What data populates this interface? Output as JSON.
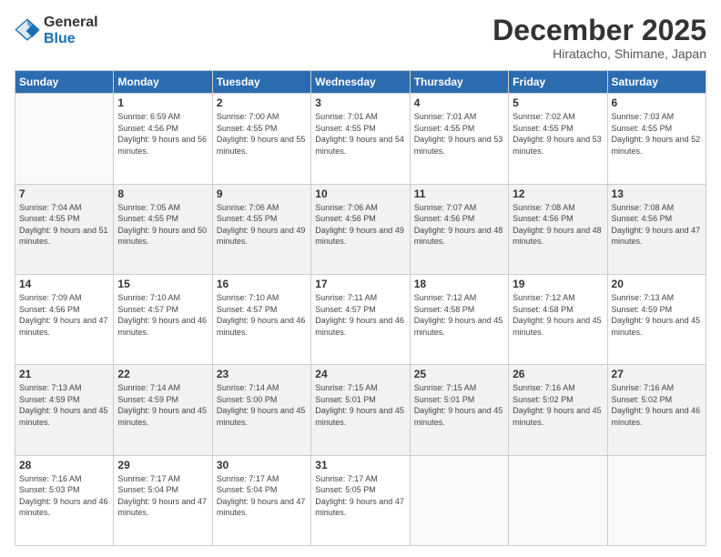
{
  "logo": {
    "line1": "General",
    "line2": "Blue"
  },
  "title": "December 2025",
  "subtitle": "Hiratacho, Shimane, Japan",
  "weekdays": [
    "Sunday",
    "Monday",
    "Tuesday",
    "Wednesday",
    "Thursday",
    "Friday",
    "Saturday"
  ],
  "weeks": [
    [
      {
        "day": "",
        "sunrise": "",
        "sunset": "",
        "daylight": ""
      },
      {
        "day": "1",
        "sunrise": "Sunrise: 6:59 AM",
        "sunset": "Sunset: 4:56 PM",
        "daylight": "Daylight: 9 hours and 56 minutes."
      },
      {
        "day": "2",
        "sunrise": "Sunrise: 7:00 AM",
        "sunset": "Sunset: 4:55 PM",
        "daylight": "Daylight: 9 hours and 55 minutes."
      },
      {
        "day": "3",
        "sunrise": "Sunrise: 7:01 AM",
        "sunset": "Sunset: 4:55 PM",
        "daylight": "Daylight: 9 hours and 54 minutes."
      },
      {
        "day": "4",
        "sunrise": "Sunrise: 7:01 AM",
        "sunset": "Sunset: 4:55 PM",
        "daylight": "Daylight: 9 hours and 53 minutes."
      },
      {
        "day": "5",
        "sunrise": "Sunrise: 7:02 AM",
        "sunset": "Sunset: 4:55 PM",
        "daylight": "Daylight: 9 hours and 53 minutes."
      },
      {
        "day": "6",
        "sunrise": "Sunrise: 7:03 AM",
        "sunset": "Sunset: 4:55 PM",
        "daylight": "Daylight: 9 hours and 52 minutes."
      }
    ],
    [
      {
        "day": "7",
        "sunrise": "Sunrise: 7:04 AM",
        "sunset": "Sunset: 4:55 PM",
        "daylight": "Daylight: 9 hours and 51 minutes."
      },
      {
        "day": "8",
        "sunrise": "Sunrise: 7:05 AM",
        "sunset": "Sunset: 4:55 PM",
        "daylight": "Daylight: 9 hours and 50 minutes."
      },
      {
        "day": "9",
        "sunrise": "Sunrise: 7:06 AM",
        "sunset": "Sunset: 4:55 PM",
        "daylight": "Daylight: 9 hours and 49 minutes."
      },
      {
        "day": "10",
        "sunrise": "Sunrise: 7:06 AM",
        "sunset": "Sunset: 4:56 PM",
        "daylight": "Daylight: 9 hours and 49 minutes."
      },
      {
        "day": "11",
        "sunrise": "Sunrise: 7:07 AM",
        "sunset": "Sunset: 4:56 PM",
        "daylight": "Daylight: 9 hours and 48 minutes."
      },
      {
        "day": "12",
        "sunrise": "Sunrise: 7:08 AM",
        "sunset": "Sunset: 4:56 PM",
        "daylight": "Daylight: 9 hours and 48 minutes."
      },
      {
        "day": "13",
        "sunrise": "Sunrise: 7:08 AM",
        "sunset": "Sunset: 4:56 PM",
        "daylight": "Daylight: 9 hours and 47 minutes."
      }
    ],
    [
      {
        "day": "14",
        "sunrise": "Sunrise: 7:09 AM",
        "sunset": "Sunset: 4:56 PM",
        "daylight": "Daylight: 9 hours and 47 minutes."
      },
      {
        "day": "15",
        "sunrise": "Sunrise: 7:10 AM",
        "sunset": "Sunset: 4:57 PM",
        "daylight": "Daylight: 9 hours and 46 minutes."
      },
      {
        "day": "16",
        "sunrise": "Sunrise: 7:10 AM",
        "sunset": "Sunset: 4:57 PM",
        "daylight": "Daylight: 9 hours and 46 minutes."
      },
      {
        "day": "17",
        "sunrise": "Sunrise: 7:11 AM",
        "sunset": "Sunset: 4:57 PM",
        "daylight": "Daylight: 9 hours and 46 minutes."
      },
      {
        "day": "18",
        "sunrise": "Sunrise: 7:12 AM",
        "sunset": "Sunset: 4:58 PM",
        "daylight": "Daylight: 9 hours and 45 minutes."
      },
      {
        "day": "19",
        "sunrise": "Sunrise: 7:12 AM",
        "sunset": "Sunset: 4:58 PM",
        "daylight": "Daylight: 9 hours and 45 minutes."
      },
      {
        "day": "20",
        "sunrise": "Sunrise: 7:13 AM",
        "sunset": "Sunset: 4:59 PM",
        "daylight": "Daylight: 9 hours and 45 minutes."
      }
    ],
    [
      {
        "day": "21",
        "sunrise": "Sunrise: 7:13 AM",
        "sunset": "Sunset: 4:59 PM",
        "daylight": "Daylight: 9 hours and 45 minutes."
      },
      {
        "day": "22",
        "sunrise": "Sunrise: 7:14 AM",
        "sunset": "Sunset: 4:59 PM",
        "daylight": "Daylight: 9 hours and 45 minutes."
      },
      {
        "day": "23",
        "sunrise": "Sunrise: 7:14 AM",
        "sunset": "Sunset: 5:00 PM",
        "daylight": "Daylight: 9 hours and 45 minutes."
      },
      {
        "day": "24",
        "sunrise": "Sunrise: 7:15 AM",
        "sunset": "Sunset: 5:01 PM",
        "daylight": "Daylight: 9 hours and 45 minutes."
      },
      {
        "day": "25",
        "sunrise": "Sunrise: 7:15 AM",
        "sunset": "Sunset: 5:01 PM",
        "daylight": "Daylight: 9 hours and 45 minutes."
      },
      {
        "day": "26",
        "sunrise": "Sunrise: 7:16 AM",
        "sunset": "Sunset: 5:02 PM",
        "daylight": "Daylight: 9 hours and 45 minutes."
      },
      {
        "day": "27",
        "sunrise": "Sunrise: 7:16 AM",
        "sunset": "Sunset: 5:02 PM",
        "daylight": "Daylight: 9 hours and 46 minutes."
      }
    ],
    [
      {
        "day": "28",
        "sunrise": "Sunrise: 7:16 AM",
        "sunset": "Sunset: 5:03 PM",
        "daylight": "Daylight: 9 hours and 46 minutes."
      },
      {
        "day": "29",
        "sunrise": "Sunrise: 7:17 AM",
        "sunset": "Sunset: 5:04 PM",
        "daylight": "Daylight: 9 hours and 47 minutes."
      },
      {
        "day": "30",
        "sunrise": "Sunrise: 7:17 AM",
        "sunset": "Sunset: 5:04 PM",
        "daylight": "Daylight: 9 hours and 47 minutes."
      },
      {
        "day": "31",
        "sunrise": "Sunrise: 7:17 AM",
        "sunset": "Sunset: 5:05 PM",
        "daylight": "Daylight: 9 hours and 47 minutes."
      },
      {
        "day": "",
        "sunrise": "",
        "sunset": "",
        "daylight": ""
      },
      {
        "day": "",
        "sunrise": "",
        "sunset": "",
        "daylight": ""
      },
      {
        "day": "",
        "sunrise": "",
        "sunset": "",
        "daylight": ""
      }
    ]
  ]
}
